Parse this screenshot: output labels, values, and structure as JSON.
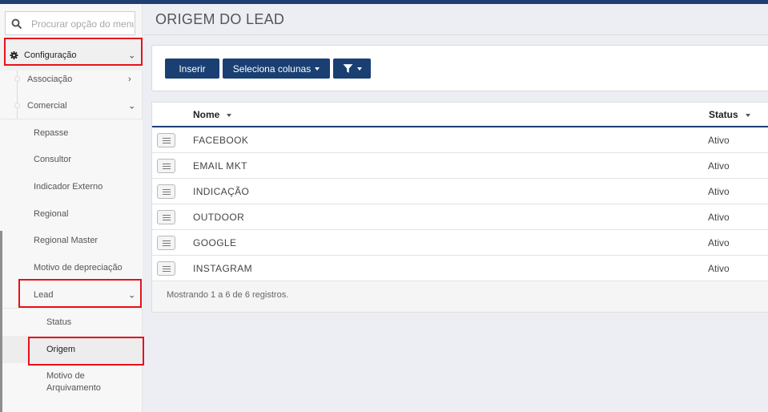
{
  "sidebar": {
    "search_placeholder": "Procurar opção do menu",
    "config_label": "Configuração",
    "items": [
      {
        "label": "Associação",
        "level": 1
      },
      {
        "label": "Comercial",
        "level": 1
      },
      {
        "label": "Repasse",
        "level": 2
      },
      {
        "label": "Consultor",
        "level": 2
      },
      {
        "label": "Indicador Externo",
        "level": 2
      },
      {
        "label": "Regional",
        "level": 2
      },
      {
        "label": "Regional Master",
        "level": 2
      },
      {
        "label": "Motivo de depreciação",
        "level": 2
      },
      {
        "label": "Lead",
        "level": 2
      },
      {
        "label": "Status",
        "level": 3
      },
      {
        "label": "Origem",
        "level": 3
      },
      {
        "label": "Motivo de Arquivamento",
        "level": 3
      }
    ]
  },
  "main": {
    "title": "ORIGEM DO LEAD",
    "toolbar": {
      "insert_label": "Inserir",
      "columns_label": "Seleciona colunas"
    },
    "table": {
      "columns": [
        "Nome",
        "Status"
      ],
      "rows": [
        {
          "nome": "FACEBOOK",
          "status": "Ativo"
        },
        {
          "nome": "EMAIL MKT",
          "status": "Ativo"
        },
        {
          "nome": "INDICAÇÃO",
          "status": "Ativo"
        },
        {
          "nome": "OUTDOOR",
          "status": "Ativo"
        },
        {
          "nome": "GOOGLE",
          "status": "Ativo"
        },
        {
          "nome": "INSTAGRAM",
          "status": "Ativo"
        }
      ],
      "footer": "Mostrando 1 a 6 de 6 registros."
    }
  },
  "icons": {
    "search": "search-icon",
    "config": "gear-icon",
    "filter": "filter-icon",
    "row_menu": "menu-icon"
  },
  "colors": {
    "accent": "#1a3f73",
    "highlight_box": "#e8101a"
  }
}
